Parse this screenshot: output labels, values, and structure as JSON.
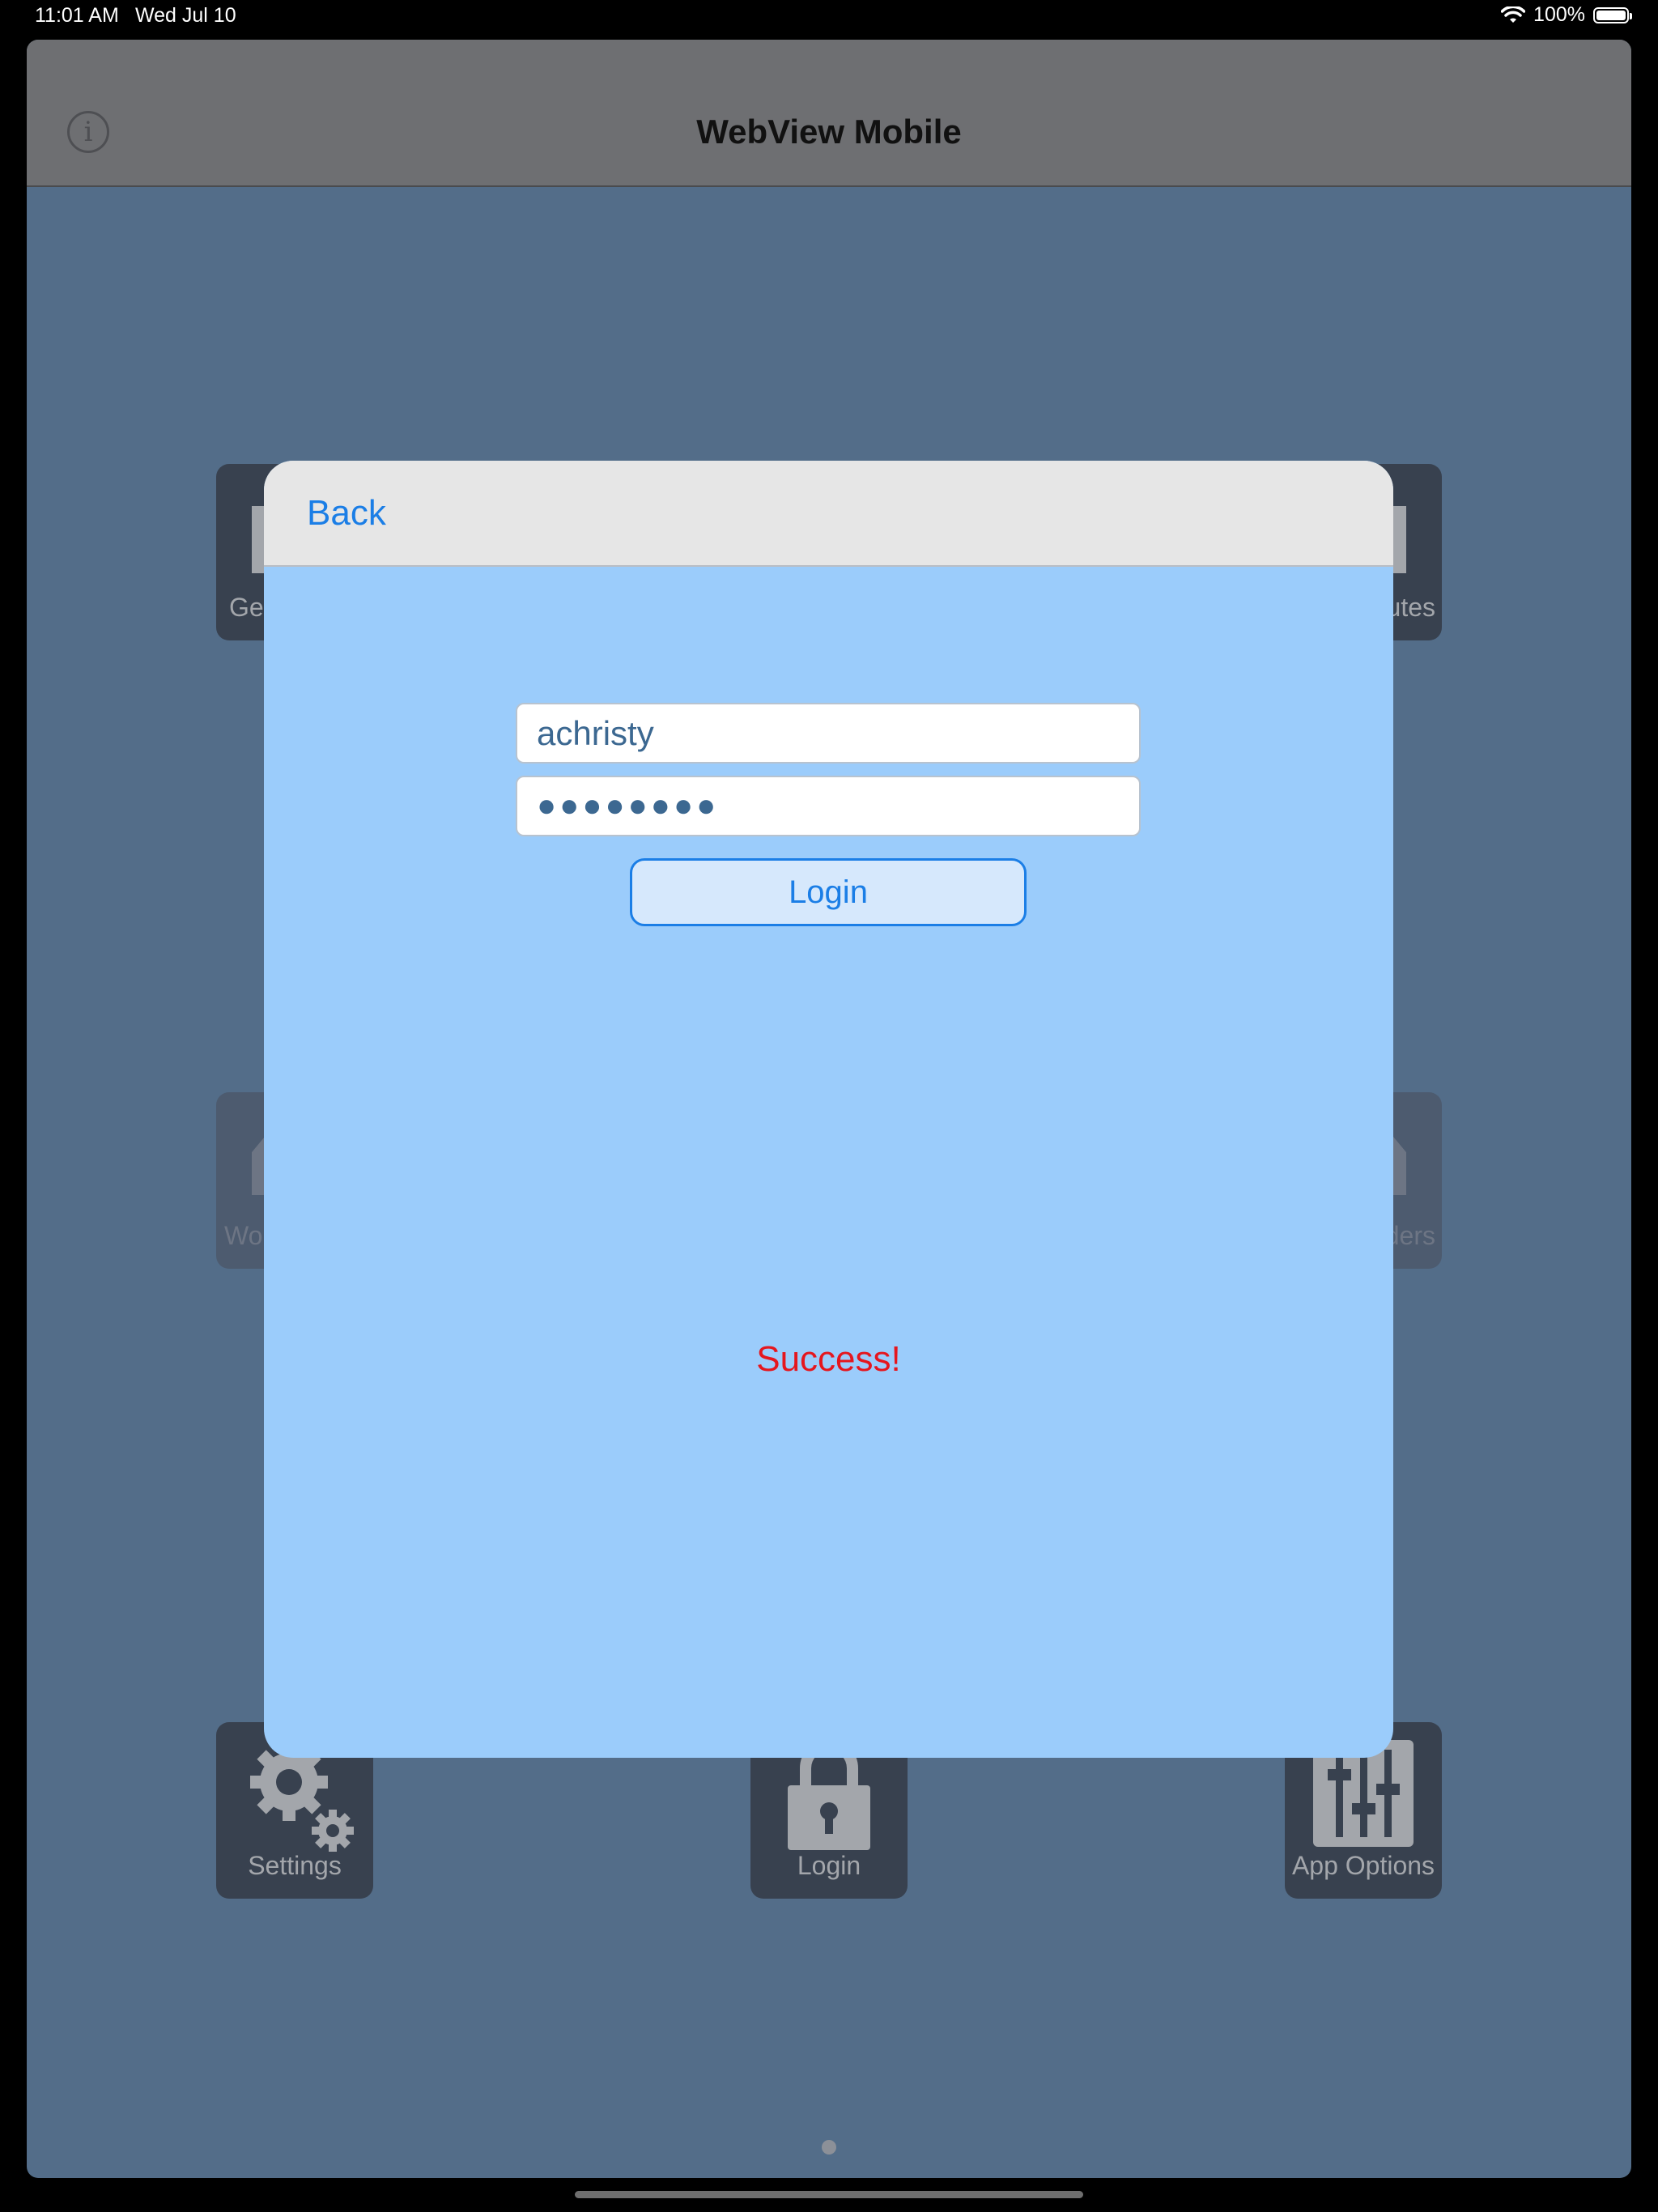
{
  "status_bar": {
    "time": "11:01 AM",
    "date": "Wed Jul 10",
    "battery": "100%",
    "icons": [
      "wifi-icon",
      "battery-icon"
    ]
  },
  "navbar": {
    "title": "WebView Mobile",
    "info_icon": "info-icon"
  },
  "tiles": [
    {
      "label": "Ge",
      "icon": "tray-icon",
      "state": "dimmed"
    },
    {
      "label": "utes",
      "icon": "tray-icon",
      "state": "dimmed"
    },
    {
      "label": "Wo",
      "icon": "tray-icon",
      "state": "disabled"
    },
    {
      "label": "ders",
      "icon": "tray-icon",
      "state": "disabled"
    },
    {
      "label": "Settings",
      "icon": "gears-icon",
      "state": "dimmed"
    },
    {
      "label": "Login",
      "icon": "lock-icon",
      "state": "dimmed"
    },
    {
      "label": "App Options",
      "icon": "sliders-icon",
      "state": "dimmed"
    }
  ],
  "modal": {
    "back_label": "Back",
    "username_value": "achristy",
    "password_value": "●●●●●●●●",
    "login_label": "Login",
    "message": "Success!",
    "colors": {
      "accent": "#1b7ee6",
      "success_text": "#e5161e",
      "modal_bg": "#9bccfb"
    }
  }
}
